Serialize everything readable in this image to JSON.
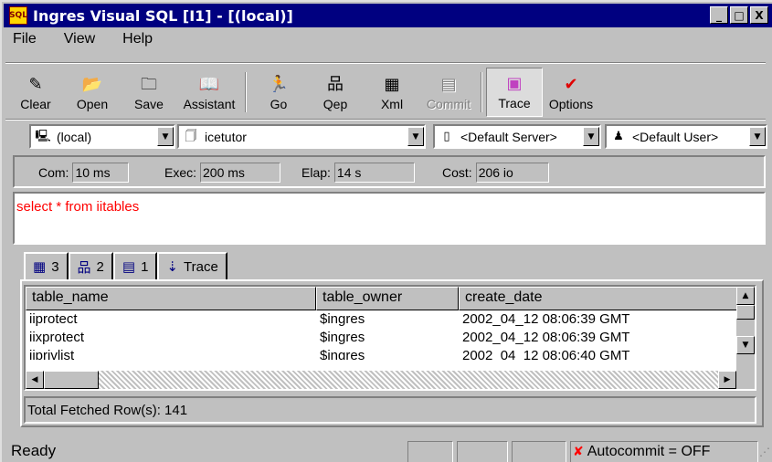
{
  "window": {
    "icon_text": "SQL",
    "title": "Ingres Visual SQL [I1] - [(local)]",
    "minimize": "_",
    "maximize": "□",
    "close": "X"
  },
  "menu": [
    "File",
    "View",
    "Help"
  ],
  "toolbar": {
    "clear": "Clear",
    "open": "Open",
    "save": "Save",
    "assistant": "Assistant",
    "go": "Go",
    "qep": "Qep",
    "xml": "Xml",
    "commit": "Commit",
    "trace": "Trace",
    "options": "Options"
  },
  "selectors": {
    "node": "(local)",
    "database": "icetutor",
    "server": "<Default Server>",
    "user": "<Default User>"
  },
  "stats": {
    "com_label": "Com:",
    "com_value": "10 ms",
    "exec_label": "Exec:",
    "exec_value": "200 ms",
    "elap_label": "Elap:",
    "elap_value": "14 s",
    "cost_label": "Cost:",
    "cost_value": "206 io"
  },
  "sql_text": "select * from iitables",
  "tabs": [
    {
      "icon": "grid-icon",
      "label": "3"
    },
    {
      "icon": "qep-icon",
      "label": "2"
    },
    {
      "icon": "xml-icon",
      "label": "1"
    },
    {
      "icon": "trace-icon",
      "label": "Trace"
    }
  ],
  "grid": {
    "columns": [
      "table_name",
      "table_owner",
      "create_date"
    ],
    "rows": [
      [
        "iiprotect",
        "$ingres",
        "2002_04_12 08:06:39 GMT"
      ],
      [
        "iixprotect",
        "$ingres",
        "2002_04_12 08:06:39 GMT"
      ],
      [
        "iiprivlist",
        "$ingres",
        "2002_04_12 08:06:40 GMT"
      ]
    ]
  },
  "fetched": "Total Fetched Row(s): 141",
  "status": {
    "ready": "Ready",
    "autocommit": "Autocommit = OFF"
  }
}
